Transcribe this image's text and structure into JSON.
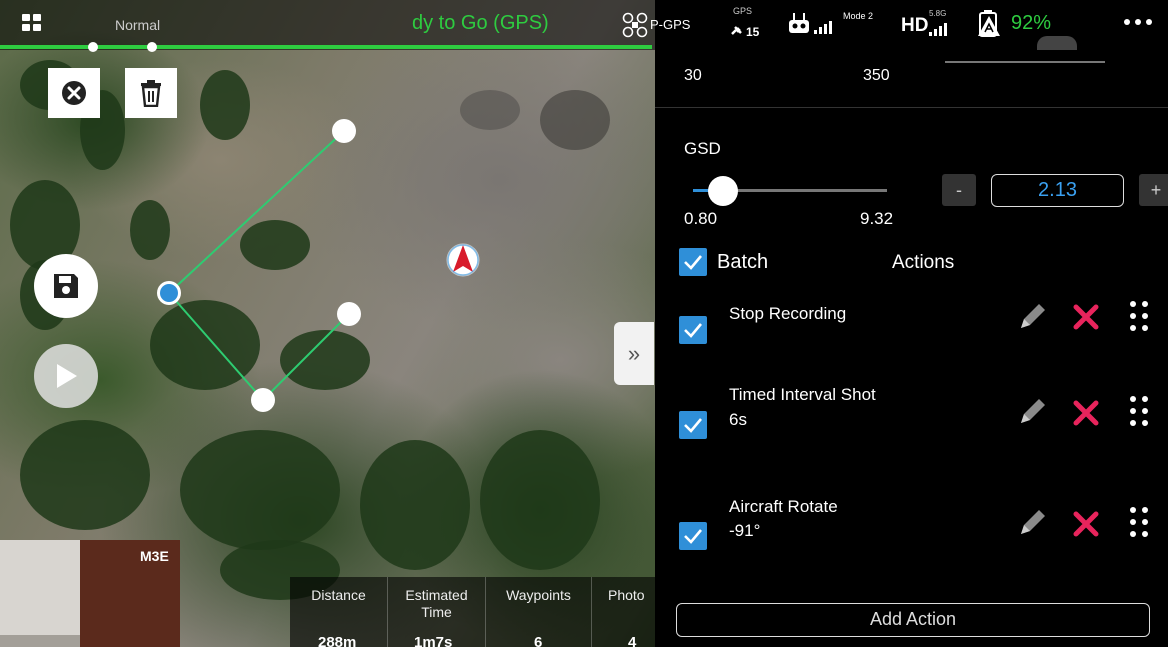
{
  "status_bar": {
    "mode": "Normal",
    "flight_status": "dy to Go (GPS)",
    "gps_mode": "P-GPS",
    "gps_label": "GPS",
    "satellites": "15",
    "rc_mode": "Mode 2",
    "hd_label": "HD",
    "hd_band": "5.8G",
    "battery_percent": "92%",
    "progress_color": "#2ecc40"
  },
  "map": {
    "camera_label": "M3E",
    "stats": [
      {
        "label": "Distance",
        "value": "288m"
      },
      {
        "label": "Estimated Time",
        "value": "1m7s"
      },
      {
        "label": "Waypoints",
        "value": "6"
      },
      {
        "label": "Photo",
        "value": "4"
      }
    ]
  },
  "panel": {
    "prev_slider_min": "30",
    "prev_slider_max": "350",
    "gsd": {
      "label": "GSD",
      "min": "0.80",
      "max": "9.32",
      "value": "2.13",
      "minus_label": "-",
      "plus_label": "+"
    },
    "batch_label": "Batch",
    "actions_header": "Actions",
    "actions": [
      {
        "title": "Stop Recording",
        "detail": ""
      },
      {
        "title": "Timed Interval Shot",
        "detail": "6s"
      },
      {
        "title": "Aircraft Rotate",
        "detail": "-91°"
      }
    ],
    "add_action_label": "Add Action",
    "accent_color": "#2f8fd8",
    "delete_color": "#e8245c"
  }
}
